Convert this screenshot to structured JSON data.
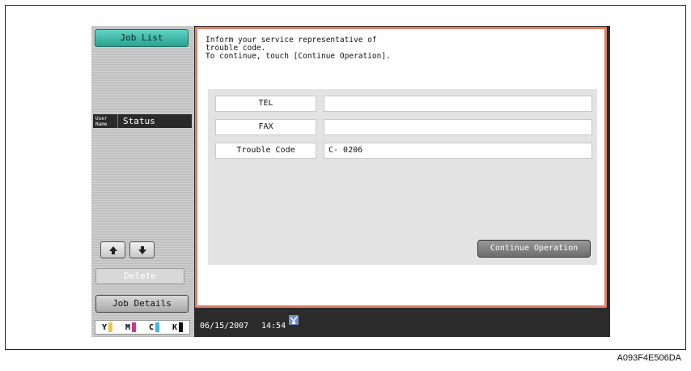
{
  "left_panel": {
    "job_list_label": "Job List",
    "tab_user_label": "User Name",
    "tab_status_label": "Status",
    "up_icon": "arrow-up-icon",
    "down_icon": "arrow-down-icon",
    "delete_label": "Delete",
    "job_details_label": "Job Details",
    "toner": [
      {
        "letter": "Y",
        "color": "#e6c84a"
      },
      {
        "letter": "M",
        "color": "#d0358f"
      },
      {
        "letter": "C",
        "color": "#3fb7e8"
      },
      {
        "letter": "K",
        "color": "#111111"
      }
    ]
  },
  "dialog": {
    "message": "Inform your service representative of\ntrouble code.\nTo continue, touch [Continue Operation].",
    "rows": [
      {
        "label": "TEL",
        "value": ""
      },
      {
        "label": "FAX",
        "value": ""
      },
      {
        "label": "Trouble Code",
        "value": "C- 0206"
      }
    ],
    "continue_label": "Continue Operation",
    "border_color": "#e0806a"
  },
  "status_bar": {
    "date": "06/15/2007",
    "time": "14:54",
    "icon": "network-icon"
  },
  "figure_caption": "A093F4E506DA"
}
